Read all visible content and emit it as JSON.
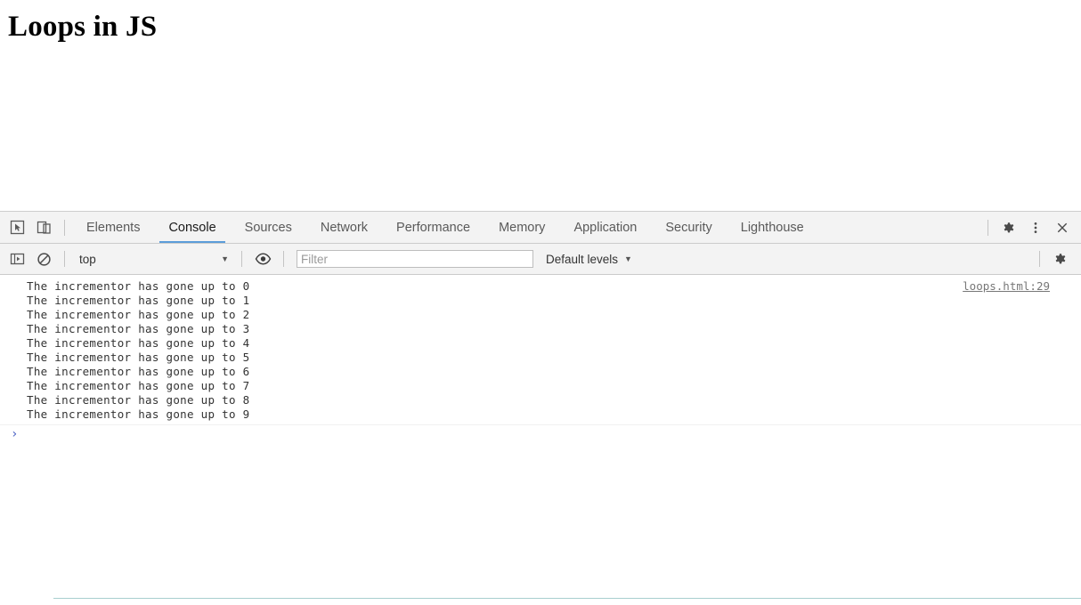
{
  "page": {
    "heading": "Loops in JS"
  },
  "devtools": {
    "left_controls": [
      {
        "name": "inspect-element-icon",
        "label": "Inspect element"
      },
      {
        "name": "device-toolbar-icon",
        "label": "Toggle device toolbar"
      }
    ],
    "tabs": [
      {
        "label": "Elements",
        "active": false
      },
      {
        "label": "Console",
        "active": true
      },
      {
        "label": "Sources",
        "active": false
      },
      {
        "label": "Network",
        "active": false
      },
      {
        "label": "Performance",
        "active": false
      },
      {
        "label": "Memory",
        "active": false
      },
      {
        "label": "Application",
        "active": false
      },
      {
        "label": "Security",
        "active": false
      },
      {
        "label": "Lighthouse",
        "active": false
      }
    ],
    "right_controls": [
      {
        "name": "gear-icon",
        "label": "Settings"
      },
      {
        "name": "kebab-menu-icon",
        "label": "Customize and control DevTools"
      },
      {
        "name": "close-icon",
        "label": "Close DevTools"
      }
    ],
    "active_tab_underline_color": "#5b9dd9"
  },
  "console_toolbar": {
    "sidebar_toggle": "console-sidebar-icon",
    "clear_console": "clear-console-icon",
    "context": {
      "value": "top",
      "caret": "▼"
    },
    "eye_toggle": "eye-icon",
    "filter": {
      "value": "",
      "placeholder": "Filter"
    },
    "levels": {
      "value": "Default levels",
      "caret": "▼"
    },
    "settings": "gear-icon"
  },
  "console": {
    "messages": [
      {
        "text": "The incrementor has gone up to 0",
        "source": "loops.html:29"
      },
      {
        "text": "The incrementor has gone up to 1",
        "source": ""
      },
      {
        "text": "The incrementor has gone up to 2",
        "source": ""
      },
      {
        "text": "The incrementor has gone up to 3",
        "source": ""
      },
      {
        "text": "The incrementor has gone up to 4",
        "source": ""
      },
      {
        "text": "The incrementor has gone up to 5",
        "source": ""
      },
      {
        "text": "The incrementor has gone up to 6",
        "source": ""
      },
      {
        "text": "The incrementor has gone up to 7",
        "source": ""
      },
      {
        "text": "The incrementor has gone up to 8",
        "source": ""
      },
      {
        "text": "The incrementor has gone up to 9",
        "source": ""
      }
    ],
    "prompt": {
      "symbol": "›",
      "value": ""
    },
    "text_color": "#333333",
    "source_link_color": "#777777",
    "prompt_color": "#4b61c4"
  }
}
